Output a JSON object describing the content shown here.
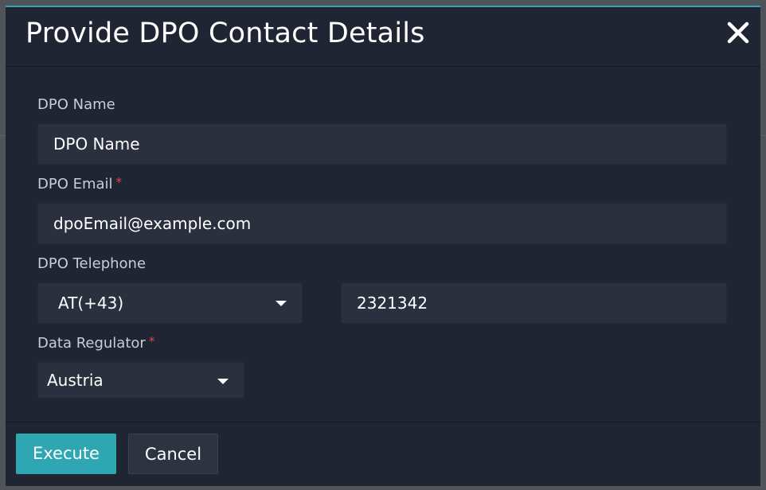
{
  "modal": {
    "title": "Provide DPO Contact Details",
    "close_icon": "close-icon"
  },
  "form": {
    "dpo_name": {
      "label": "DPO Name",
      "value": "DPO Name"
    },
    "dpo_email": {
      "label": "DPO Email",
      "required_marker": "*",
      "value": "dpoEmail@example.com"
    },
    "dpo_telephone": {
      "label": "DPO Telephone",
      "country_code": "AT(+43)",
      "number": "2321342"
    },
    "data_regulator": {
      "label": "Data Regulator",
      "required_marker": "*",
      "value": "Austria"
    }
  },
  "footer": {
    "execute_label": "Execute",
    "cancel_label": "Cancel"
  },
  "colors": {
    "accent": "#2ea7b2",
    "modal_bg": "#1f2532",
    "input_bg": "#2a303d",
    "required": "#e0484e"
  }
}
